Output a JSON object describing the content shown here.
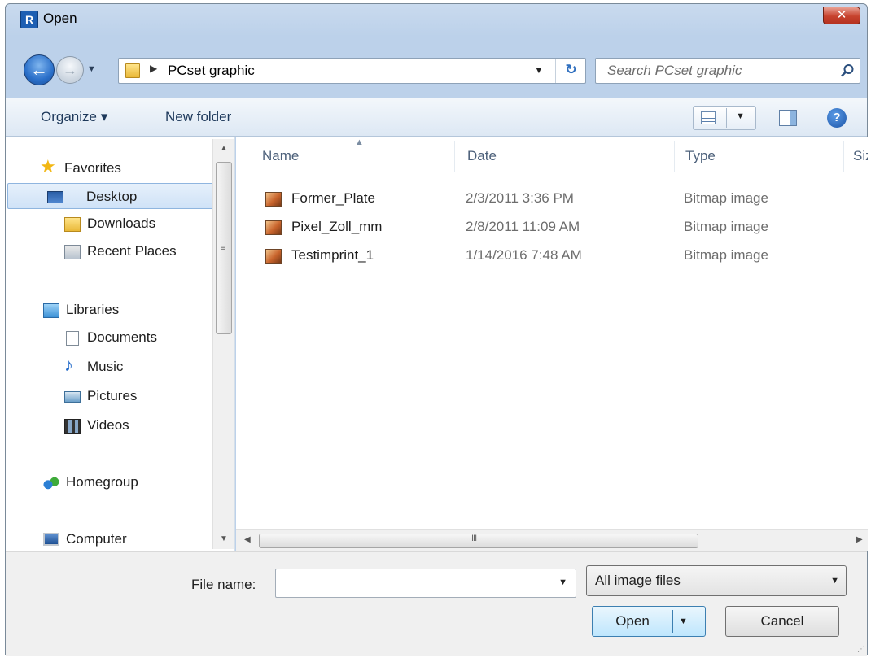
{
  "window": {
    "title": "Open",
    "app_icon_letter": "R",
    "close_glyph": "✕"
  },
  "address": {
    "breadcrumb": "PCset graphic",
    "search_placeholder": "Search PCset graphic"
  },
  "toolbar": {
    "organize": "Organize ▾",
    "new_folder": "New folder"
  },
  "nav": {
    "items": [
      {
        "label": "Favorites",
        "icon": "star-icon"
      },
      {
        "label": "Desktop",
        "icon": "desktop-icon",
        "selected": true
      },
      {
        "label": "Downloads",
        "icon": "downloads-folder-icon"
      },
      {
        "label": "Recent Places",
        "icon": "recent-places-icon"
      },
      {
        "label": "Libraries",
        "icon": "libraries-icon"
      },
      {
        "label": "Documents",
        "icon": "documents-icon"
      },
      {
        "label": "Music",
        "icon": "music-icon"
      },
      {
        "label": "Pictures",
        "icon": "pictures-icon"
      },
      {
        "label": "Videos",
        "icon": "videos-icon"
      },
      {
        "label": "Homegroup",
        "icon": "homegroup-icon"
      },
      {
        "label": "Computer",
        "icon": "computer-icon"
      }
    ]
  },
  "files": {
    "columns": [
      "Name",
      "Date",
      "Type",
      "Size"
    ],
    "rows": [
      {
        "name": "Former_Plate",
        "date": "2/3/2011 3:36 PM",
        "type": "Bitmap image"
      },
      {
        "name": "Pixel_Zoll_mm",
        "date": "2/8/2011 11:09 AM",
        "type": "Bitmap image"
      },
      {
        "name": "Testimprint_1",
        "date": "1/14/2016 7:48 AM",
        "type": "Bitmap image"
      }
    ]
  },
  "bottom": {
    "file_name_label": "File name:",
    "file_name_value": "",
    "filter": "All image files",
    "open": "Open",
    "cancel": "Cancel"
  }
}
